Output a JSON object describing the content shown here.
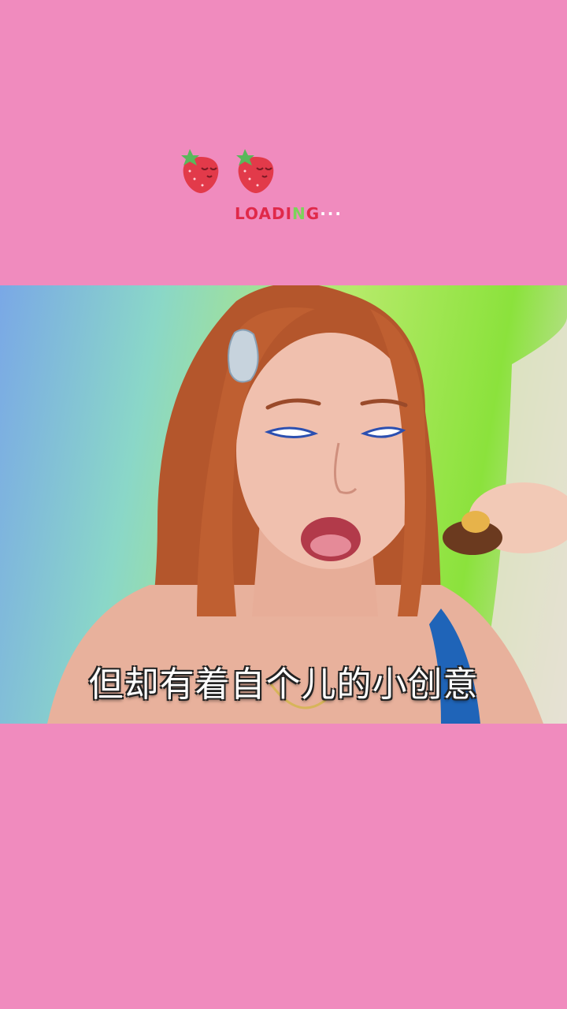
{
  "loading": {
    "text_main": "LOADI",
    "text_accent": "N",
    "text_tail": "G",
    "dots": "···"
  },
  "video": {
    "subtitle": "但却有着自个儿的小创意"
  },
  "colors": {
    "background": "#f08bbe",
    "loading_text": "#e0294a",
    "loading_accent": "#7bd35a"
  }
}
